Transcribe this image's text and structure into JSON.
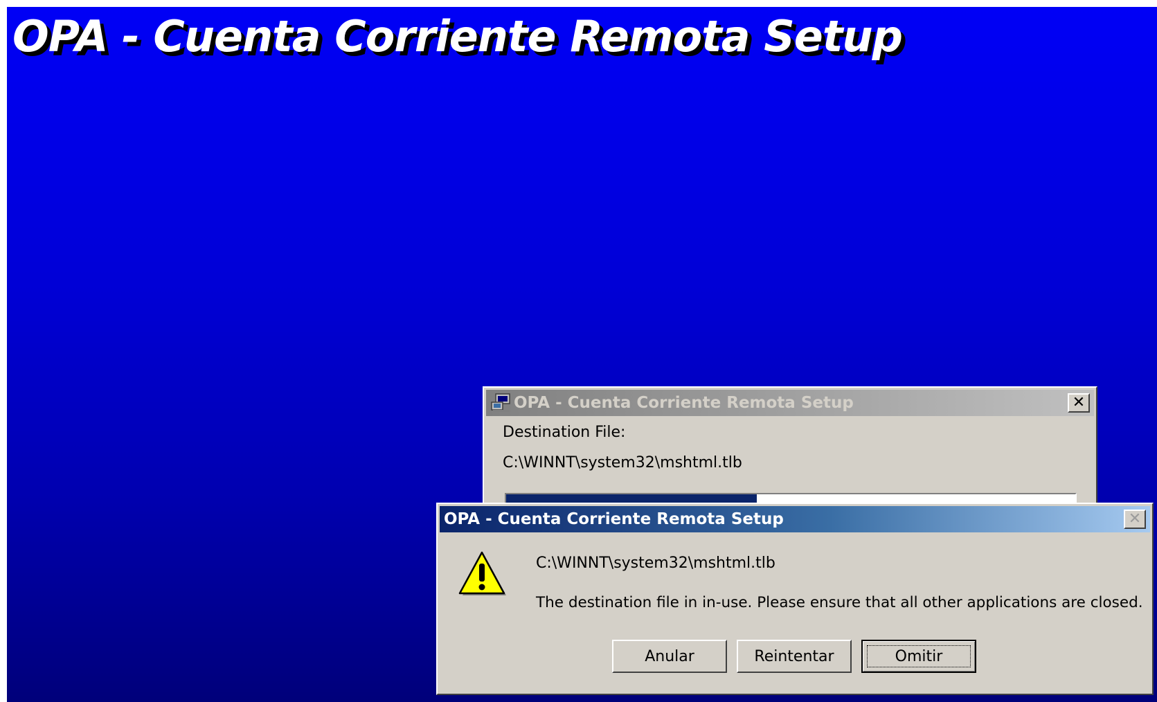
{
  "background": {
    "title": "OPA - Cuenta Corriente Remota Setup",
    "gradient_top": "#0000f6",
    "gradient_bottom": "#00007a"
  },
  "progress_dialog": {
    "title": "OPA - Cuenta Corriente Remota Setup",
    "title_icon": "setup-computer-icon",
    "close_icon": "close-icon",
    "close_label": "✕",
    "label": "Destination File:",
    "file_path": "C:\\WINNT\\system32\\mshtml.tlb",
    "progress_fraction": 0.44
  },
  "error_dialog": {
    "title": "OPA - Cuenta Corriente Remota Setup",
    "icon": "warning-icon",
    "close_icon": "close-icon",
    "close_label": "✕",
    "file_path": "C:\\WINNT\\system32\\mshtml.tlb",
    "message": "The destination file in in-use.  Please ensure that all other applications are closed.",
    "buttons": {
      "abort": "Anular",
      "retry": "Reintentar",
      "ignore": "Omitir"
    }
  },
  "colors": {
    "active_title": "#0a246a",
    "inactive_title": "#808080",
    "dialog_face": "#d4d0c8"
  }
}
